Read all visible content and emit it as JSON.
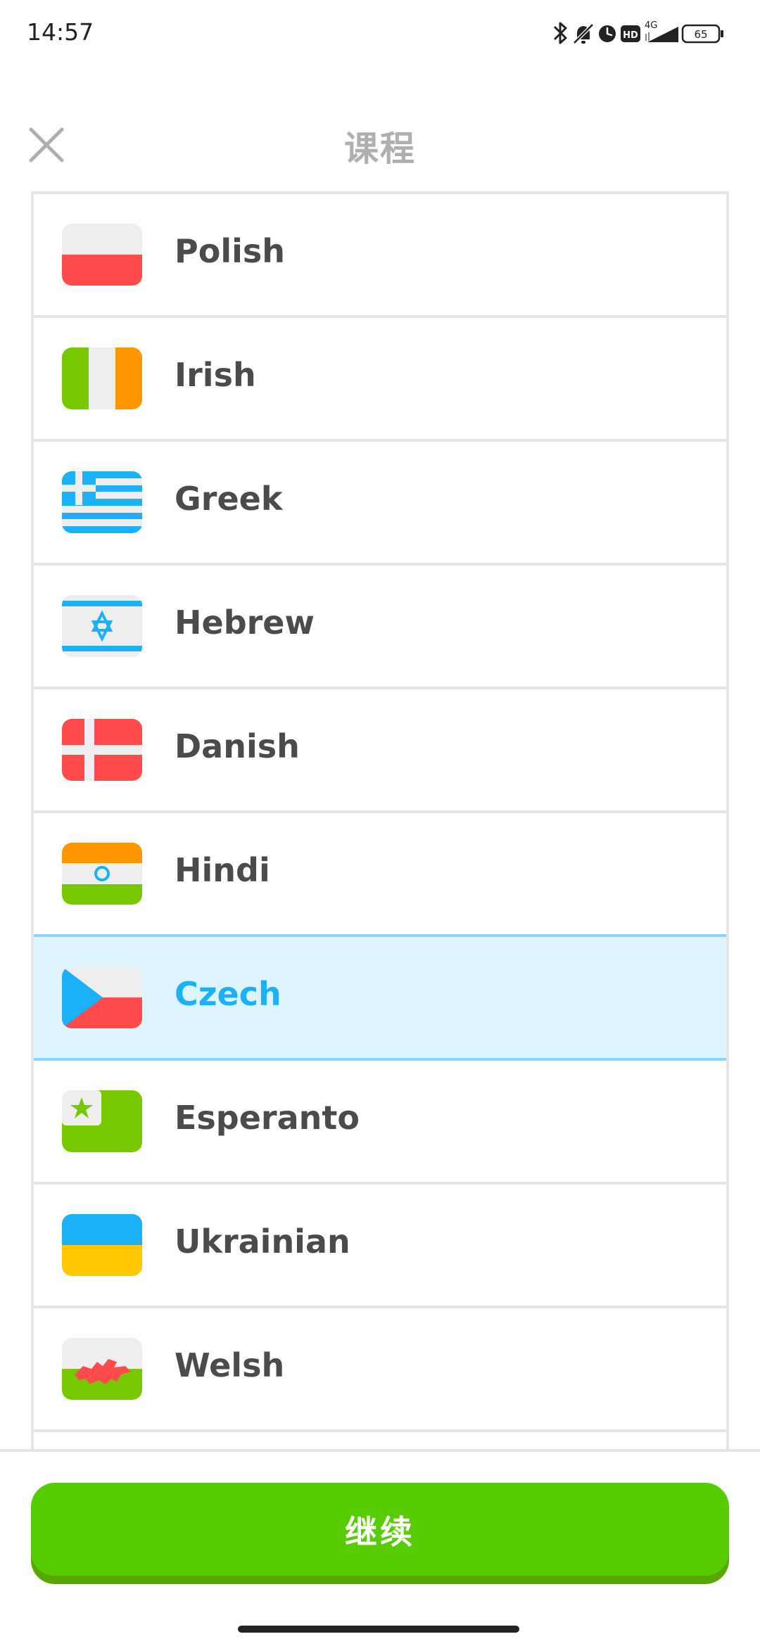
{
  "status_bar": {
    "time": "14:57",
    "network": "4G",
    "battery": "65",
    "icons": [
      "bluetooth-icon",
      "mute-icon",
      "alarm-icon",
      "hd-icon",
      "signal-icon",
      "battery-icon"
    ]
  },
  "header": {
    "title": "课程",
    "close_icon": "close-icon"
  },
  "courses": [
    {
      "name": "Polish",
      "flag": "poland-flag-icon",
      "selected": false
    },
    {
      "name": "Irish",
      "flag": "ireland-flag-icon",
      "selected": false
    },
    {
      "name": "Greek",
      "flag": "greece-flag-icon",
      "selected": false
    },
    {
      "name": "Hebrew",
      "flag": "israel-flag-icon",
      "selected": false
    },
    {
      "name": "Danish",
      "flag": "denmark-flag-icon",
      "selected": false
    },
    {
      "name": "Hindi",
      "flag": "india-flag-icon",
      "selected": false
    },
    {
      "name": "Czech",
      "flag": "czech-flag-icon",
      "selected": true
    },
    {
      "name": "Esperanto",
      "flag": "esperanto-flag-icon",
      "selected": false
    },
    {
      "name": "Ukrainian",
      "flag": "ukraine-flag-icon",
      "selected": false
    },
    {
      "name": "Welsh",
      "flag": "wales-flag-icon",
      "selected": false
    }
  ],
  "footer": {
    "continue_label": "继续"
  },
  "colors": {
    "accent_green": "#58cc02",
    "accent_green_shadow": "#58a700",
    "selected_bg": "#ddf4ff",
    "selected_border": "#84d8ff",
    "selected_text": "#1cb0f6",
    "text": "#4b4b4b",
    "title": "#afafaf",
    "divider": "#e5e5e5"
  }
}
